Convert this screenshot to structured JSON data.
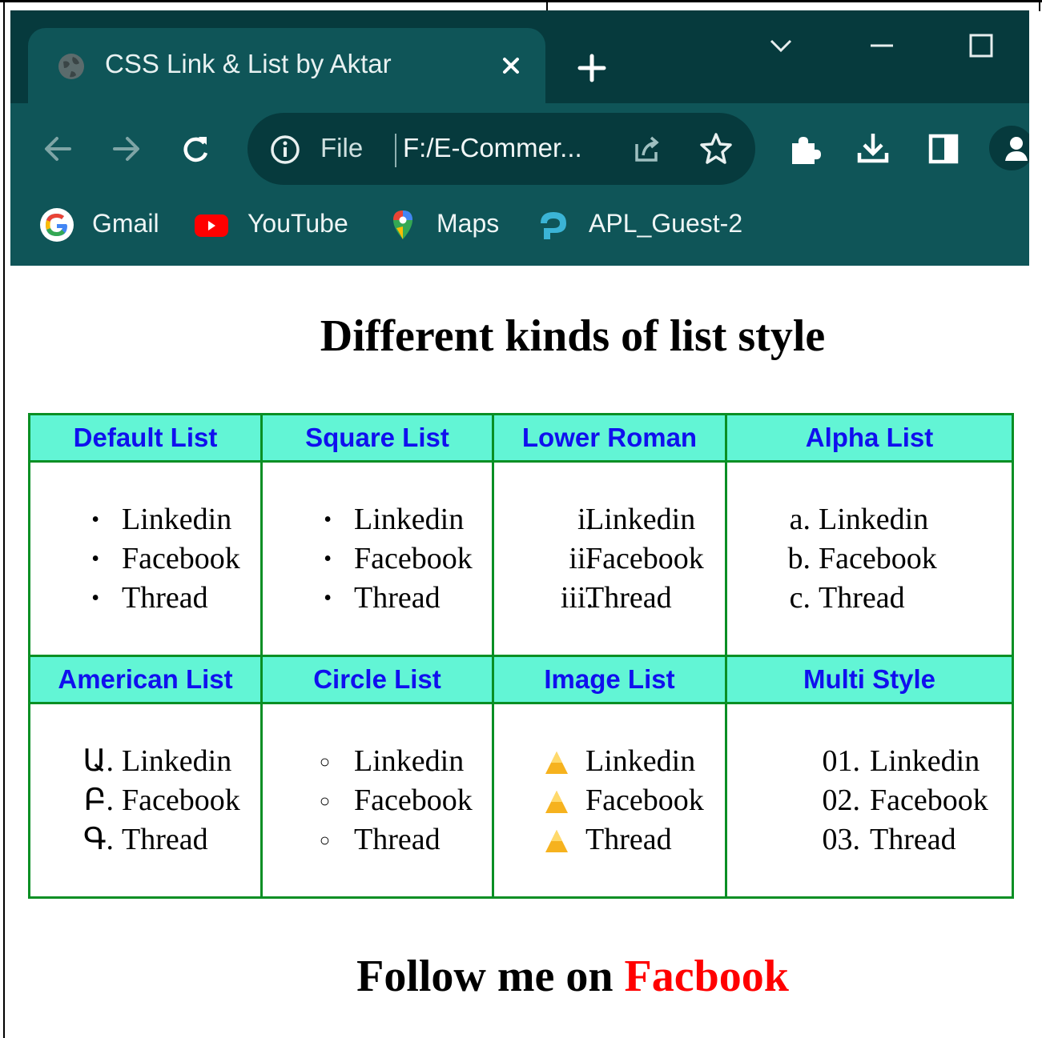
{
  "browser": {
    "tab_title": "CSS Link & List by Aktar",
    "address": {
      "security_label": "File",
      "url_text": "F:/E-Commer..."
    },
    "bookmarks": [
      {
        "label": "Gmail",
        "icon": "google-icon"
      },
      {
        "label": "YouTube",
        "icon": "youtube-icon"
      },
      {
        "label": "Maps",
        "icon": "maps-icon"
      },
      {
        "label": "APL_Guest-2",
        "icon": "wifi-key-icon"
      }
    ],
    "colors": {
      "tabstrip": "#063a3d",
      "toolbar": "#0f5558"
    }
  },
  "page": {
    "heading": "Different kinds of list style",
    "table": {
      "header_color": "#62f5d5",
      "header_text_color": "#1010ee",
      "border_color": "#0a8f24",
      "rows": [
        {
          "headers": [
            "Default List",
            "Square List",
            "Lower Roman",
            "Alpha List"
          ],
          "cells": [
            {
              "style": "disc",
              "markers": [
                "•",
                "•",
                "•"
              ],
              "items": [
                "Linkedin",
                "Facebook",
                "Thread"
              ]
            },
            {
              "style": "square",
              "markers": [
                "•",
                "•",
                "•"
              ],
              "items": [
                "Linkedin",
                "Facebook",
                "Thread"
              ]
            },
            {
              "style": "lower-roman",
              "markers": [
                "i.",
                "ii.",
                "iii."
              ],
              "items": [
                "Linkedin",
                "Facebook",
                "Thread"
              ]
            },
            {
              "style": "lower-alpha",
              "markers": [
                "a.",
                "b.",
                "c."
              ],
              "items": [
                "Linkedin",
                "Facebook",
                "Thread"
              ]
            }
          ]
        },
        {
          "headers": [
            "American List",
            "Circle List",
            "Image List",
            "Multi Style"
          ],
          "cells": [
            {
              "style": "armenian",
              "markers": [
                "Ա.",
                "Բ.",
                "Գ."
              ],
              "items": [
                "Linkedin",
                "Facebook",
                "Thread"
              ]
            },
            {
              "style": "circle",
              "markers": [
                "○",
                "○",
                "○"
              ],
              "items": [
                "Linkedin",
                "Facebook",
                "Thread"
              ]
            },
            {
              "style": "image",
              "markers": [
                "",
                "",
                ""
              ],
              "items": [
                "Linkedin",
                "Facebook",
                "Thread"
              ]
            },
            {
              "style": "decimal-leading-zero",
              "markers": [
                "01.",
                "02.",
                "03."
              ],
              "items": [
                "Linkedin",
                "Facebook",
                "Thread"
              ]
            }
          ]
        }
      ]
    },
    "follow": {
      "prefix": "Follow me on",
      "link": "Facbook",
      "link_color": "#ff0000"
    }
  }
}
